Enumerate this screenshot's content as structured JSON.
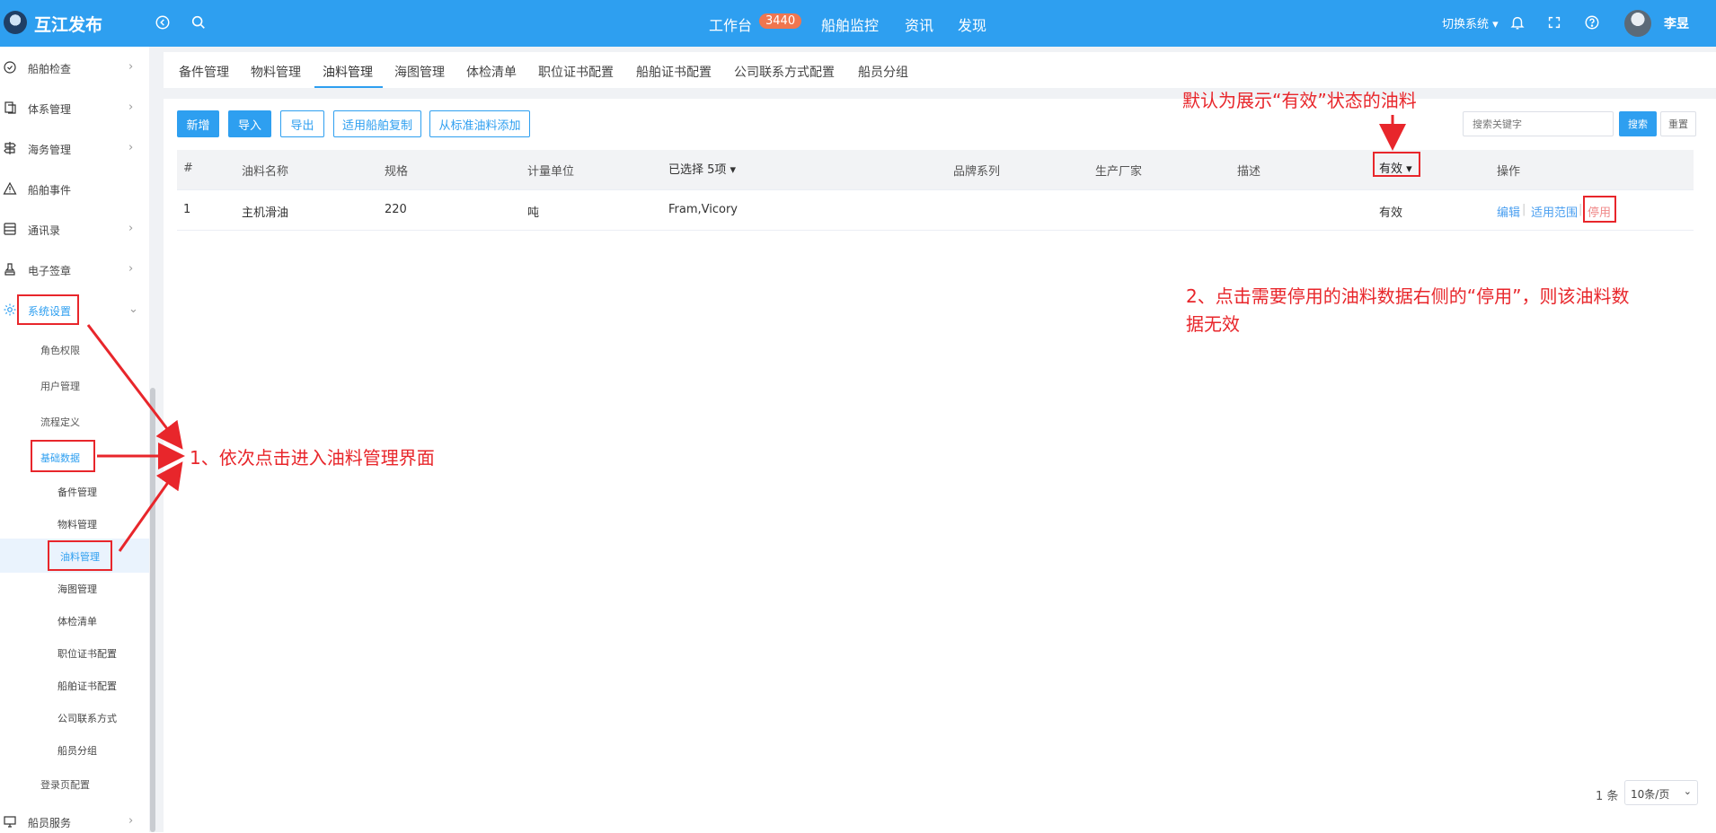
{
  "header": {
    "logo_text": "互江发布",
    "nav": [
      "工作台",
      "船舶监控",
      "资讯",
      "发现"
    ],
    "workbench_badge": "3440",
    "switch_system": "切换系统",
    "username": "李昱"
  },
  "sidebar": {
    "items": [
      {
        "label": "船舶检查",
        "icon": "check-circle-icon"
      },
      {
        "label": "体系管理",
        "icon": "document-icon"
      },
      {
        "label": "海务管理",
        "icon": "signpost-icon"
      },
      {
        "label": "船舶事件",
        "icon": "warning-icon"
      },
      {
        "label": "通讯录",
        "icon": "contacts-icon"
      },
      {
        "label": "电子签章",
        "icon": "stamp-icon"
      },
      {
        "label": "系统设置",
        "icon": "gear-icon"
      }
    ],
    "system_sub": [
      "角色权限",
      "用户管理",
      "流程定义",
      "基础数据"
    ],
    "basic_data_sub": [
      "备件管理",
      "物料管理",
      "油料管理",
      "海图管理",
      "体检清单",
      "职位证书配置",
      "船舶证书配置",
      "公司联系方式",
      "船员分组"
    ],
    "login_config": "登录页配置",
    "crew_service": "船员服务"
  },
  "tabs": [
    "备件管理",
    "物料管理",
    "油料管理",
    "海图管理",
    "体检清单",
    "职位证书配置",
    "船舶证书配置",
    "公司联系方式配置",
    "船员分组"
  ],
  "toolbar": {
    "add": "新增",
    "import": "导入",
    "export": "导出",
    "copy_ship": "适用船舶复制",
    "add_from_standard": "从标准油料添加",
    "search_placeholder": "搜索关键字",
    "search": "搜索",
    "reset": "重置"
  },
  "table": {
    "headers": [
      "#",
      "油料名称",
      "规格",
      "计量单位",
      "已选择 5项",
      "品牌系列",
      "生产厂家",
      "描述",
      "有效",
      "操作"
    ],
    "rows": [
      {
        "index": "1",
        "name": "主机滑油",
        "spec": "220",
        "unit": "吨",
        "selected": "Fram,Vicory",
        "brand": "",
        "maker": "",
        "desc": "",
        "status": "有效"
      }
    ],
    "ops": [
      "编辑",
      "适用范围",
      "停用"
    ]
  },
  "pager": {
    "total": "1 条",
    "page_size": "10条/页"
  },
  "annotations": {
    "top_note": "默认为展示“有效”状态的油料",
    "step1": "1、依次点击进入油料管理界面",
    "step2_line1": "2、点击需要停用的油料数据右侧的“停用”，则该油料数",
    "step2_line2": "据无效",
    "color": "#e8262b"
  }
}
